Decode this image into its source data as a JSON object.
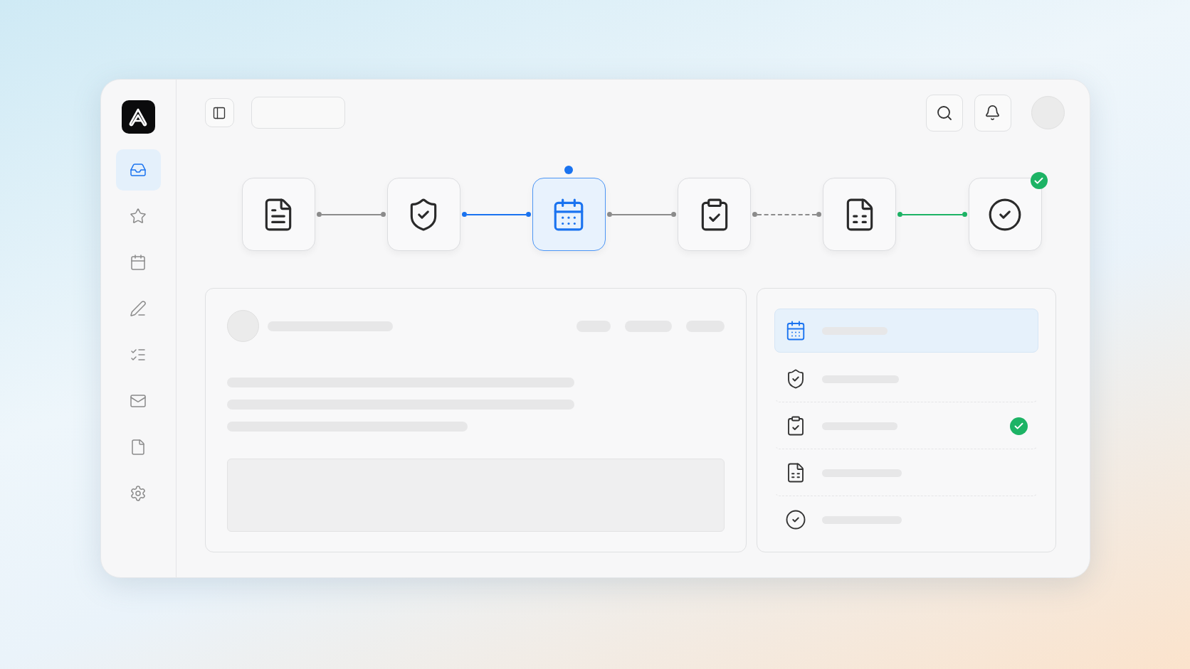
{
  "sidebar": {
    "items": [
      {
        "kind": "inbox",
        "selected": true
      },
      {
        "kind": "star",
        "selected": false
      },
      {
        "kind": "calendar",
        "selected": false
      },
      {
        "kind": "pen",
        "selected": false
      },
      {
        "kind": "checklist",
        "selected": false
      },
      {
        "kind": "mail",
        "selected": false
      },
      {
        "kind": "file",
        "selected": false
      },
      {
        "kind": "settings",
        "selected": false
      }
    ]
  },
  "pipeline": {
    "steps": [
      {
        "kind": "document",
        "selected": false,
        "done": false
      },
      {
        "kind": "shield",
        "selected": false,
        "done": false
      },
      {
        "kind": "calendar",
        "selected": true,
        "done": false
      },
      {
        "kind": "clipboard",
        "selected": false,
        "done": false
      },
      {
        "kind": "sheet",
        "selected": false,
        "done": false
      },
      {
        "kind": "check",
        "selected": false,
        "done": true
      }
    ],
    "connectors": [
      {
        "kind": "solid",
        "color": "#8c8c8c"
      },
      {
        "kind": "solid",
        "color": "#1a73f0"
      },
      {
        "kind": "solid",
        "color": "#8c8c8c"
      },
      {
        "kind": "dashed",
        "color": "#8c8c8c"
      },
      {
        "kind": "solid",
        "color": "#1db365"
      }
    ]
  },
  "list": {
    "items": [
      {
        "kind": "calendar",
        "selected": true,
        "checked": false
      },
      {
        "kind": "shield",
        "selected": false,
        "checked": false
      },
      {
        "kind": "clipboard",
        "selected": false,
        "checked": true
      },
      {
        "kind": "sheet",
        "selected": false,
        "checked": false
      },
      {
        "kind": "check",
        "selected": false,
        "checked": false
      }
    ]
  }
}
